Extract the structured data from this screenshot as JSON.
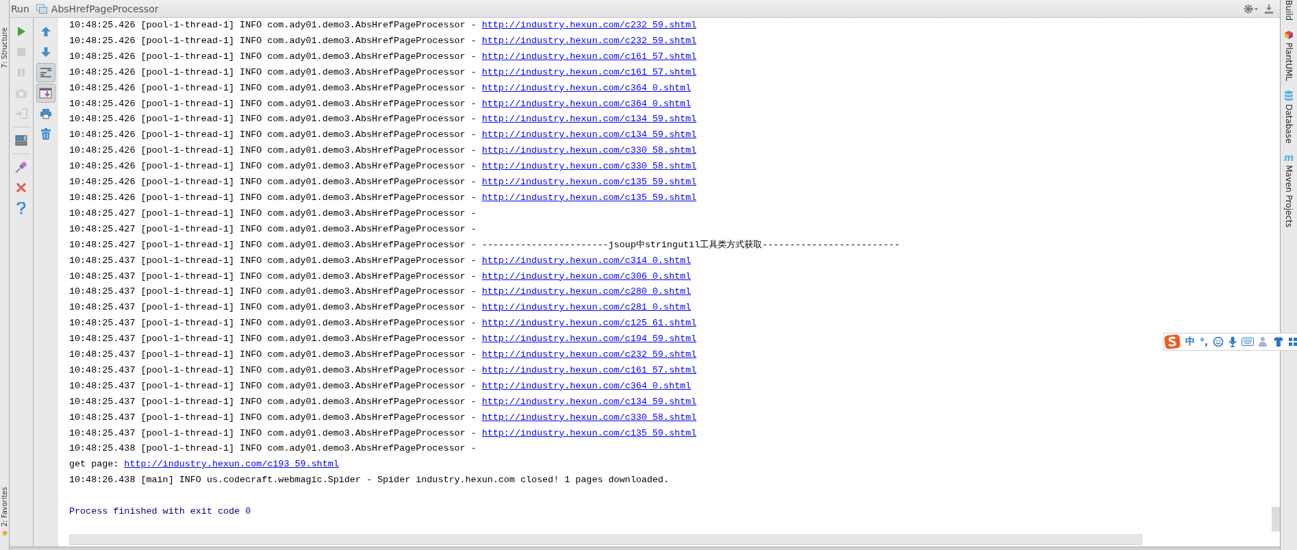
{
  "tool_window": {
    "title": "Run",
    "tab": "AbsHrefPageProcessor"
  },
  "left_stripe": [
    {
      "label": "7: Structure",
      "kind": "structure"
    },
    {
      "label": "2: Favorites",
      "kind": "favorites"
    }
  ],
  "toolbar_main": [
    [
      {
        "kind": "run",
        "disabled": false
      },
      {
        "kind": "stop",
        "disabled": true
      },
      {
        "kind": "pause",
        "disabled": true
      },
      {
        "kind": "dump",
        "disabled": true
      },
      {
        "kind": "exit",
        "disabled": true
      }
    ],
    [
      {
        "kind": "layout",
        "disabled": false
      }
    ],
    [
      {
        "kind": "pin",
        "disabled": false
      },
      {
        "kind": "close",
        "disabled": false
      },
      {
        "kind": "help",
        "disabled": false
      }
    ]
  ],
  "toolbar_side": [
    {
      "kind": "up",
      "on": false
    },
    {
      "kind": "down",
      "on": false
    },
    {
      "kind": "wrap",
      "on": true
    },
    {
      "kind": "scroll",
      "on": true
    },
    {
      "kind": "print",
      "on": false
    },
    {
      "kind": "clear",
      "on": false
    }
  ],
  "console": {
    "lines": [
      {
        "kind": "log",
        "text": "10:48:25.426 [pool-1-thread-1] INFO com.ady01.demo3.AbsHrefPageProcessor - ",
        "link": "http://industry.hexun.com/c232_59.shtml"
      },
      {
        "kind": "log",
        "text": "10:48:25.426 [pool-1-thread-1] INFO com.ady01.demo3.AbsHrefPageProcessor - ",
        "link": "http://industry.hexun.com/c232_59.shtml"
      },
      {
        "kind": "log",
        "text": "10:48:25.426 [pool-1-thread-1] INFO com.ady01.demo3.AbsHrefPageProcessor - ",
        "link": "http://industry.hexun.com/c161_57.shtml"
      },
      {
        "kind": "log",
        "text": "10:48:25.426 [pool-1-thread-1] INFO com.ady01.demo3.AbsHrefPageProcessor - ",
        "link": "http://industry.hexun.com/c161_57.shtml"
      },
      {
        "kind": "log",
        "text": "10:48:25.426 [pool-1-thread-1] INFO com.ady01.demo3.AbsHrefPageProcessor - ",
        "link": "http://industry.hexun.com/c364_0.shtml"
      },
      {
        "kind": "log",
        "text": "10:48:25.426 [pool-1-thread-1] INFO com.ady01.demo3.AbsHrefPageProcessor - ",
        "link": "http://industry.hexun.com/c364_0.shtml"
      },
      {
        "kind": "log",
        "text": "10:48:25.426 [pool-1-thread-1] INFO com.ady01.demo3.AbsHrefPageProcessor - ",
        "link": "http://industry.hexun.com/c134_59.shtml"
      },
      {
        "kind": "log",
        "text": "10:48:25.426 [pool-1-thread-1] INFO com.ady01.demo3.AbsHrefPageProcessor - ",
        "link": "http://industry.hexun.com/c134_59.shtml"
      },
      {
        "kind": "log",
        "text": "10:48:25.426 [pool-1-thread-1] INFO com.ady01.demo3.AbsHrefPageProcessor - ",
        "link": "http://industry.hexun.com/c330_58.shtml"
      },
      {
        "kind": "log",
        "text": "10:48:25.426 [pool-1-thread-1] INFO com.ady01.demo3.AbsHrefPageProcessor - ",
        "link": "http://industry.hexun.com/c330_58.shtml"
      },
      {
        "kind": "log",
        "text": "10:48:25.426 [pool-1-thread-1] INFO com.ady01.demo3.AbsHrefPageProcessor - ",
        "link": "http://industry.hexun.com/c135_59.shtml"
      },
      {
        "kind": "log",
        "text": "10:48:25.426 [pool-1-thread-1] INFO com.ady01.demo3.AbsHrefPageProcessor - ",
        "link": "http://industry.hexun.com/c135_59.shtml"
      },
      {
        "kind": "log",
        "text": "10:48:25.427 [pool-1-thread-1] INFO com.ady01.demo3.AbsHrefPageProcessor -"
      },
      {
        "kind": "log",
        "text": "10:48:25.427 [pool-1-thread-1] INFO com.ady01.demo3.AbsHrefPageProcessor -"
      },
      {
        "kind": "log",
        "text": "10:48:25.427 [pool-1-thread-1] INFO com.ady01.demo3.AbsHrefPageProcessor - -----------------------jsoup中stringutil工具类方式获取-------------------------"
      },
      {
        "kind": "log",
        "text": "10:48:25.437 [pool-1-thread-1] INFO com.ady01.demo3.AbsHrefPageProcessor - ",
        "link": "http://industry.hexun.com/c314_0.shtml"
      },
      {
        "kind": "log",
        "text": "10:48:25.437 [pool-1-thread-1] INFO com.ady01.demo3.AbsHrefPageProcessor - ",
        "link": "http://industry.hexun.com/c306_0.shtml"
      },
      {
        "kind": "log",
        "text": "10:48:25.437 [pool-1-thread-1] INFO com.ady01.demo3.AbsHrefPageProcessor - ",
        "link": "http://industry.hexun.com/c280_0.shtml"
      },
      {
        "kind": "log",
        "text": "10:48:25.437 [pool-1-thread-1] INFO com.ady01.demo3.AbsHrefPageProcessor - ",
        "link": "http://industry.hexun.com/c281_0.shtml"
      },
      {
        "kind": "log",
        "text": "10:48:25.437 [pool-1-thread-1] INFO com.ady01.demo3.AbsHrefPageProcessor - ",
        "link": "http://industry.hexun.com/c125_61.shtml"
      },
      {
        "kind": "log",
        "text": "10:48:25.437 [pool-1-thread-1] INFO com.ady01.demo3.AbsHrefPageProcessor - ",
        "link": "http://industry.hexun.com/c194_59.shtml"
      },
      {
        "kind": "log",
        "text": "10:48:25.437 [pool-1-thread-1] INFO com.ady01.demo3.AbsHrefPageProcessor - ",
        "link": "http://industry.hexun.com/c232_59.shtml"
      },
      {
        "kind": "log",
        "text": "10:48:25.437 [pool-1-thread-1] INFO com.ady01.demo3.AbsHrefPageProcessor - ",
        "link": "http://industry.hexun.com/c161_57.shtml"
      },
      {
        "kind": "log",
        "text": "10:48:25.437 [pool-1-thread-1] INFO com.ady01.demo3.AbsHrefPageProcessor - ",
        "link": "http://industry.hexun.com/c364_0.shtml"
      },
      {
        "kind": "log",
        "text": "10:48:25.437 [pool-1-thread-1] INFO com.ady01.demo3.AbsHrefPageProcessor - ",
        "link": "http://industry.hexun.com/c134_59.shtml"
      },
      {
        "kind": "log",
        "text": "10:48:25.437 [pool-1-thread-1] INFO com.ady01.demo3.AbsHrefPageProcessor - ",
        "link": "http://industry.hexun.com/c330_58.shtml"
      },
      {
        "kind": "log",
        "text": "10:48:25.437 [pool-1-thread-1] INFO com.ady01.demo3.AbsHrefPageProcessor - ",
        "link": "http://industry.hexun.com/c135_59.shtml"
      },
      {
        "kind": "log",
        "text": "10:48:25.438 [pool-1-thread-1] INFO com.ady01.demo3.AbsHrefPageProcessor -"
      },
      {
        "kind": "log",
        "text": "get page: ",
        "link": "http://industry.hexun.com/c193_59.shtml"
      },
      {
        "kind": "log",
        "text": "10:48:26.438 [main] INFO us.codecraft.webmagic.Spider - Spider industry.hexun.com closed! 1 pages downloaded."
      },
      {
        "kind": "exit",
        "text": "Process finished with exit code 0"
      }
    ]
  },
  "right_stripe": [
    {
      "kind": "build",
      "label": "Build"
    },
    {
      "kind": "plantuml",
      "label": "PlantUML"
    },
    {
      "kind": "database",
      "label": "Database"
    },
    {
      "kind": "maven",
      "label": "Maven Projects",
      "glyph": "m"
    }
  ],
  "ime_toolbar": {
    "mode": "中",
    "punctuation": "°,"
  }
}
